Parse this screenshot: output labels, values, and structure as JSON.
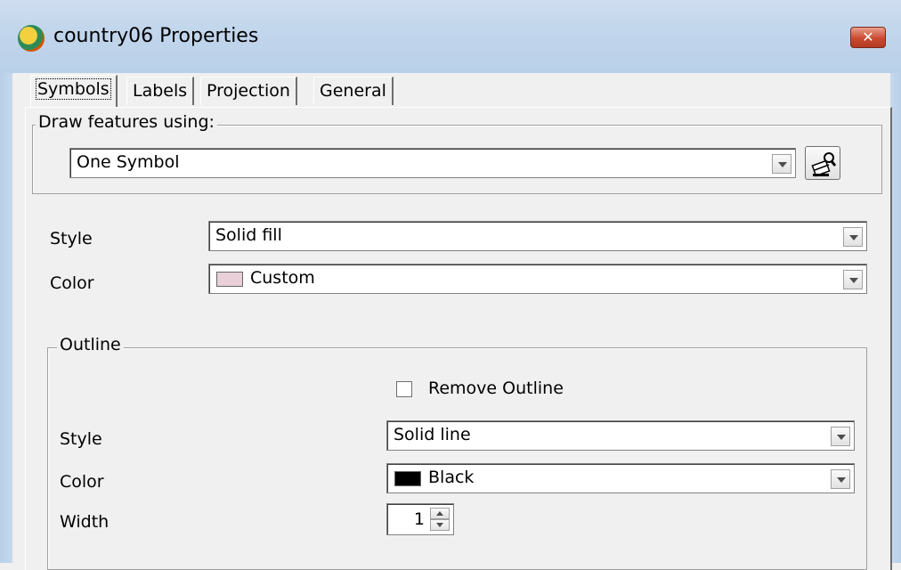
{
  "window": {
    "title": "country06 Properties",
    "close_label": "✕"
  },
  "tabs": [
    {
      "label": "Symbols",
      "selected": true
    },
    {
      "label": "Labels",
      "selected": false
    },
    {
      "label": "Projection",
      "selected": false
    },
    {
      "label": "General",
      "selected": false
    }
  ],
  "draw_features": {
    "group_label": "Draw features using:",
    "selected": "One Symbol",
    "symbol_button_icon": "paint-bucket-icon"
  },
  "fill": {
    "style_label": "Style",
    "style_value": "Solid fill",
    "color_label": "Color",
    "color_value": "Custom",
    "color_swatch": "#e8cfd8"
  },
  "outline": {
    "group_label": "Outline",
    "remove_outline_label": "Remove Outline",
    "remove_outline_checked": false,
    "style_label": "Style",
    "style_value": "Solid line",
    "color_label": "Color",
    "color_value": "Black",
    "color_swatch": "#000000",
    "width_label": "Width",
    "width_value": "1"
  }
}
